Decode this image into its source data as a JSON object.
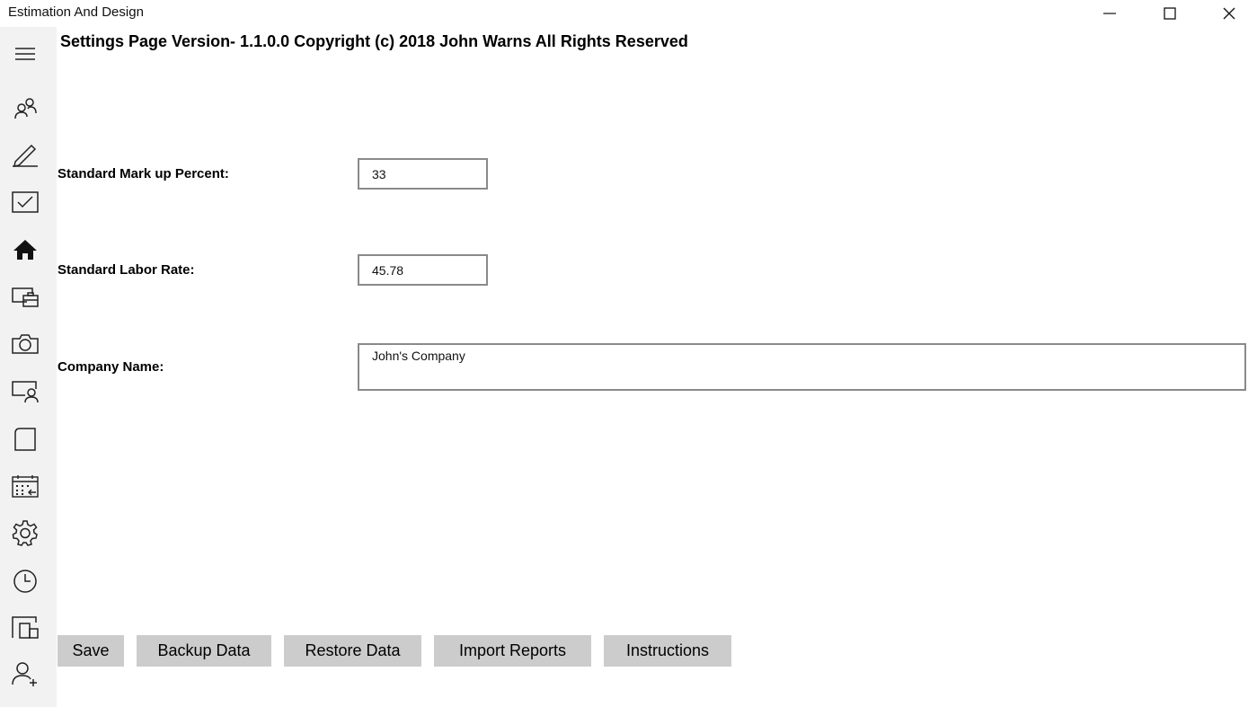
{
  "window": {
    "title": "Estimation And Design"
  },
  "sidebar": {
    "items": [
      {
        "icon": "hamburger-menu-icon"
      },
      {
        "icon": "people-icon"
      },
      {
        "icon": "pen-icon"
      },
      {
        "icon": "checkbox-icon"
      },
      {
        "icon": "home-icon"
      },
      {
        "icon": "devices-icon"
      },
      {
        "icon": "camera-icon"
      },
      {
        "icon": "contact-card-icon"
      },
      {
        "icon": "page-icon"
      },
      {
        "icon": "calendar-icon"
      },
      {
        "icon": "gear-icon"
      },
      {
        "icon": "clock-icon"
      },
      {
        "icon": "tiles-icon"
      },
      {
        "icon": "add-user-icon"
      }
    ]
  },
  "page": {
    "title": "Settings Page Version- 1.1.0.0 Copyright (c) 2018 John Warns All Rights Reserved"
  },
  "fields": {
    "markup": {
      "label": "Standard Mark up Percent:",
      "value": "33"
    },
    "labor_rate": {
      "label": "Standard Labor Rate:",
      "value": "45.78"
    },
    "company": {
      "label": "Company Name:",
      "value": "John's Company"
    }
  },
  "buttons": {
    "save": "Save",
    "backup": "Backup Data",
    "restore": "Restore Data",
    "import": "Import Reports",
    "instructions": "Instructions"
  },
  "colors": {
    "sidebar_bg": "#f2f2f2",
    "button_bg": "#cccccc",
    "input_border": "#8a8a8a"
  }
}
